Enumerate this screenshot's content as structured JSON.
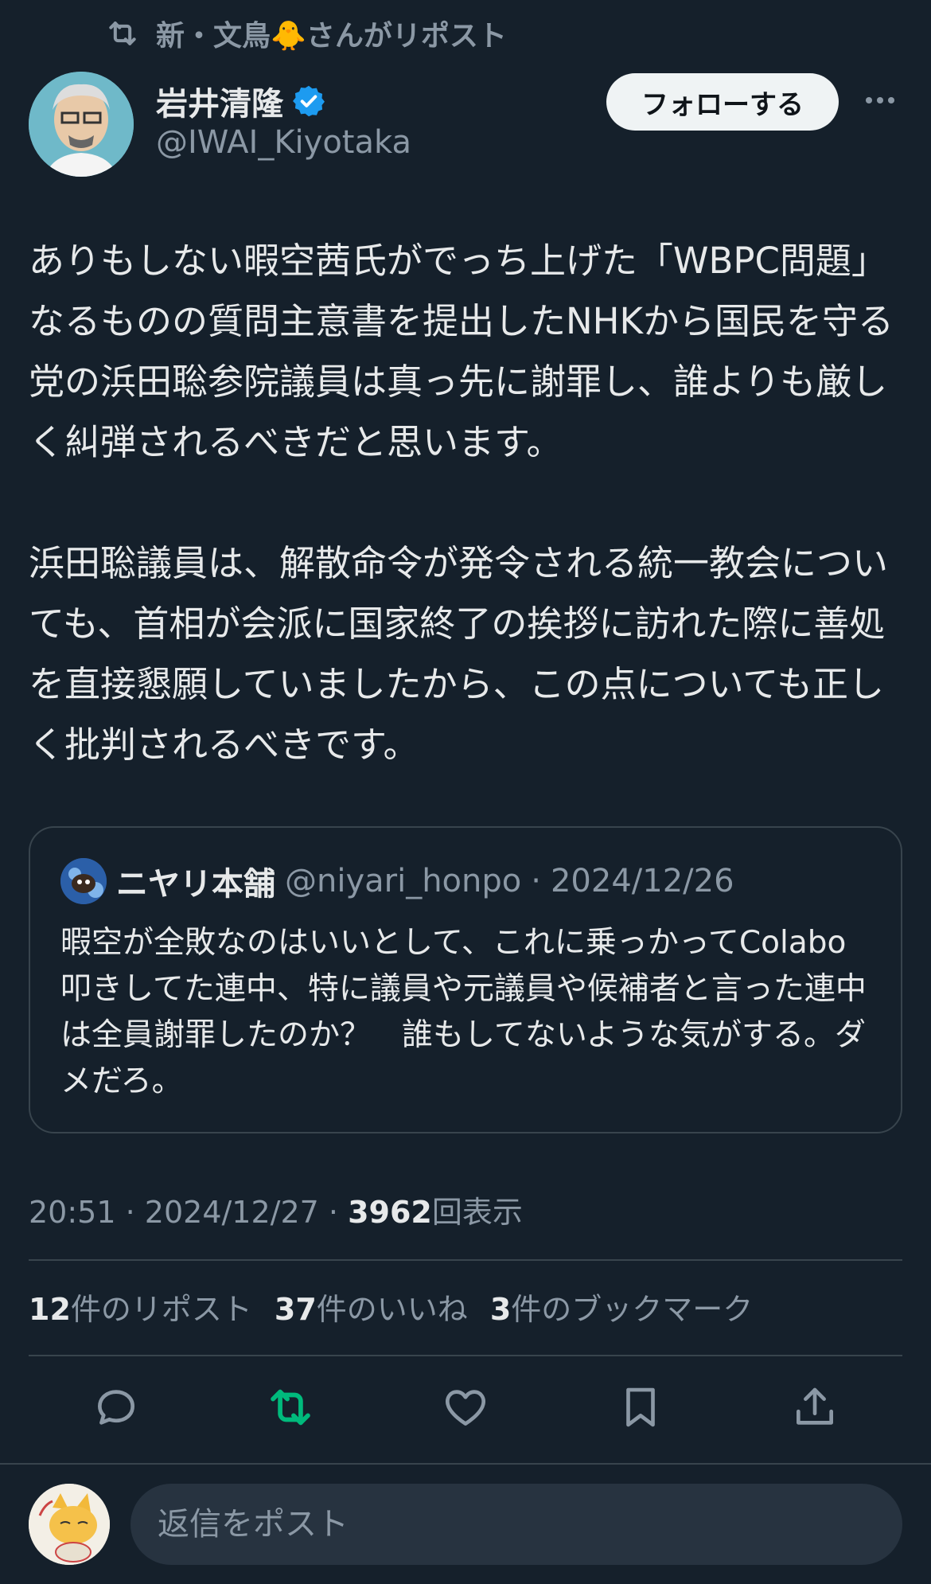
{
  "repost_context": {
    "text": "新・文鳥🐥さんがリポスト",
    "icon": "repost-icon"
  },
  "author": {
    "name": "岩井清隆",
    "handle": "@IWAI_Kiyotaka",
    "verified": true,
    "follow_label": "フォローする"
  },
  "tweet": {
    "text": "ありもしない暇空茜氏がでっち上げた「WBPC問題」なるものの質問主意書を提出したNHKから国民を守る党の浜田聡参院議員は真っ先に謝罪し、誰よりも厳しく糾弾されるべきだと思います。\n\n浜田聡議員は、解散命令が発令される統一教会についても、首相が会派に国家終了の挨拶に訪れた際に善処を直接懇願していましたから、この点についても正しく批判されるべきです。"
  },
  "quote": {
    "name": "ニヤリ本舗",
    "handle": "@niyari_honpo",
    "date": "2024/12/26",
    "separator": "·",
    "text": "暇空が全敗なのはいいとして、これに乗っかってColabo叩きしてた連中、特に議員や元議員や候補者と言った連中は全員謝罪したのか？　誰もしてないような気がする。ダメだろ。"
  },
  "meta": {
    "time": "20:51",
    "date": "2024/12/27",
    "views": "3962",
    "views_label": "回表示",
    "separator": "·"
  },
  "stats": {
    "reposts": "12",
    "reposts_label": "件のリポスト",
    "likes": "37",
    "likes_label": "件のいいね",
    "bookmarks": "3",
    "bookmarks_label": "件のブックマーク"
  },
  "actions": [
    "reply-icon",
    "repost-icon",
    "like-icon",
    "bookmark-icon",
    "share-icon"
  ],
  "reply_box": {
    "placeholder": "返信をポスト"
  },
  "colors": {
    "background": "#15202b",
    "text": "#e7e9ea",
    "muted": "#8b98a5",
    "border": "#38444d",
    "repost_active": "#00ba7c",
    "verified": "#1d9bf0"
  }
}
